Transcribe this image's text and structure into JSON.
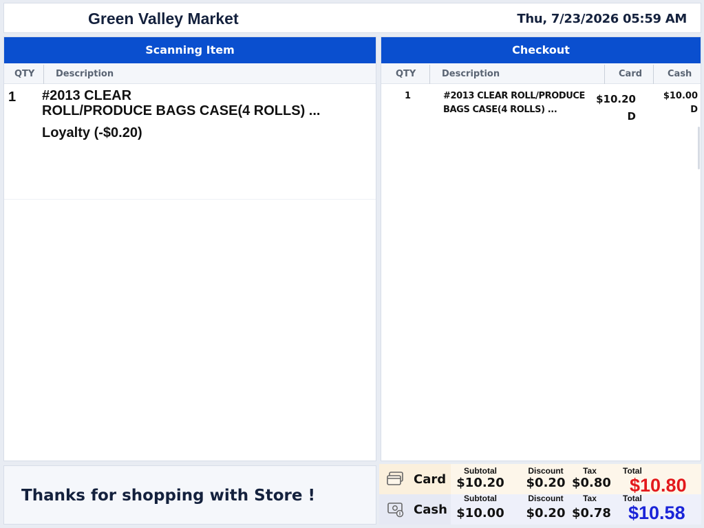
{
  "header": {
    "store_name": "Green Valley Market",
    "datetime": "Thu, 7/23/2026 05:59 AM"
  },
  "scan": {
    "title": "Scanning Item",
    "col_qty": "QTY",
    "col_desc": "Description",
    "item": {
      "qty": "1",
      "line1": "#2013 CLEAR",
      "line2": "ROLL/PRODUCE BAGS CASE(4 ROLLS) ...",
      "loyalty": "Loyalty (-$0.20)"
    }
  },
  "checkout": {
    "title": "Checkout",
    "col_qty": "QTY",
    "col_desc": "Description",
    "col_card": "Card",
    "col_cash": "Cash",
    "items": [
      {
        "qty": "1",
        "desc_line1": "#2013 CLEAR ROLL/PRODUCE",
        "desc_line2": "BAGS CASE(4 ROLLS) ...",
        "card_price": "$10.20",
        "card_flag": "D",
        "cash_price": "$10.00",
        "cash_flag": "D"
      }
    ]
  },
  "footer": {
    "thanks": "Thanks for shopping with Store !"
  },
  "totals": {
    "labels": {
      "subtotal": "Subtotal",
      "discount": "Discount",
      "tax": "Tax",
      "total": "Total"
    },
    "card": {
      "label": "Card",
      "subtotal": "$10.20",
      "discount": "$0.20",
      "tax": "$0.80",
      "total": "$10.80",
      "total_color": "#e3191c",
      "icon": "card-icon"
    },
    "cash": {
      "label": "Cash",
      "subtotal": "$10.00",
      "discount": "$0.20",
      "tax": "$0.78",
      "total": "$10.58",
      "total_color": "#1a24d8",
      "icon": "cash-icon"
    }
  },
  "colors": {
    "accent": "#0a4fcf"
  }
}
